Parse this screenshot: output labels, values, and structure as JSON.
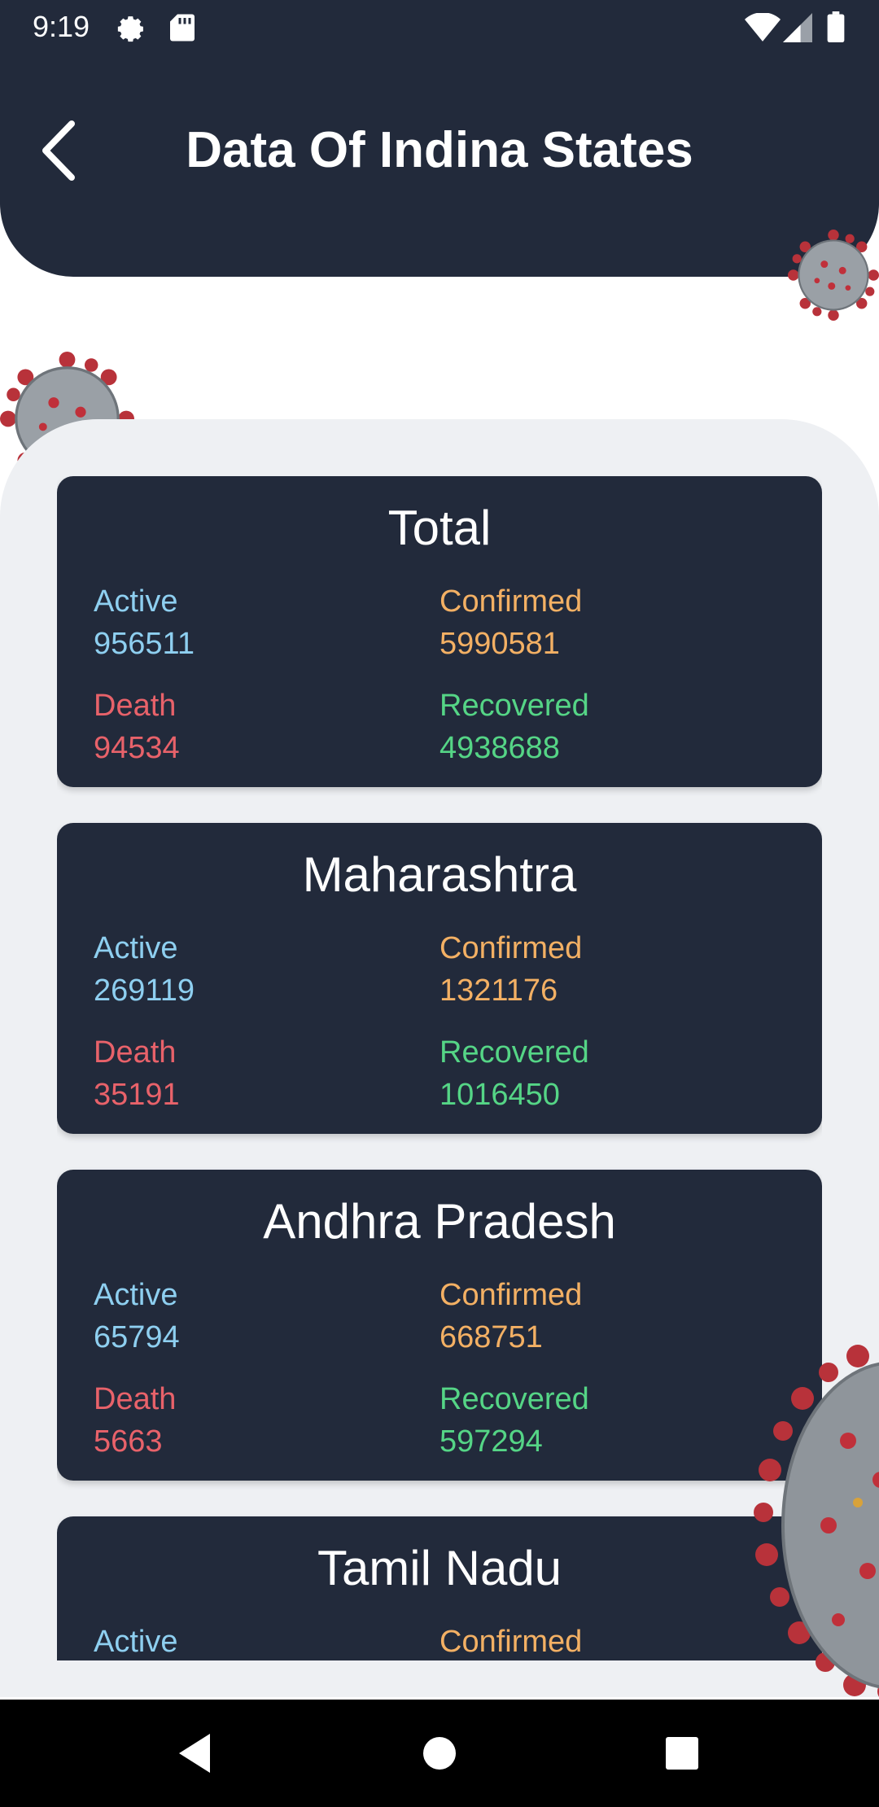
{
  "status_bar": {
    "time": "9:19",
    "icons": [
      "settings-icon",
      "sd-card-icon",
      "wifi-icon",
      "signal-icon",
      "battery-icon"
    ]
  },
  "header": {
    "title": "Data Of Indina States",
    "back_icon": "back-arrow-icon"
  },
  "states": [
    {
      "name": "Total",
      "active_label": "Active",
      "active": "956511",
      "confirmed_label": "Confirmed",
      "confirmed": "5990581",
      "death_label": "Death",
      "death": "94534",
      "recovered_label": "Recovered",
      "recovered": "4938688"
    },
    {
      "name": "Maharashtra",
      "active_label": "Active",
      "active": "269119",
      "confirmed_label": "Confirmed",
      "confirmed": "1321176",
      "death_label": "Death",
      "death": "35191",
      "recovered_label": "Recovered",
      "recovered": "1016450"
    },
    {
      "name": "Andhra Pradesh",
      "active_label": "Active",
      "active": "65794",
      "confirmed_label": "Confirmed",
      "confirmed": "668751",
      "death_label": "Death",
      "death": "5663",
      "recovered_label": "Recovered",
      "recovered": "597294"
    },
    {
      "name": "Tamil Nadu",
      "active_label": "Active",
      "confirmed_label": "Confirmed"
    }
  ],
  "colors": {
    "header_bg": "#222a3b",
    "card_bg": "#222a3b",
    "panel_bg": "#eef0f3",
    "active": "#8ecff0",
    "confirmed": "#f3b064",
    "death": "#e8626a",
    "recovered": "#55d586"
  },
  "nav_bar": {
    "icons": [
      "back-triangle-icon",
      "home-circle-icon",
      "recents-square-icon"
    ]
  }
}
